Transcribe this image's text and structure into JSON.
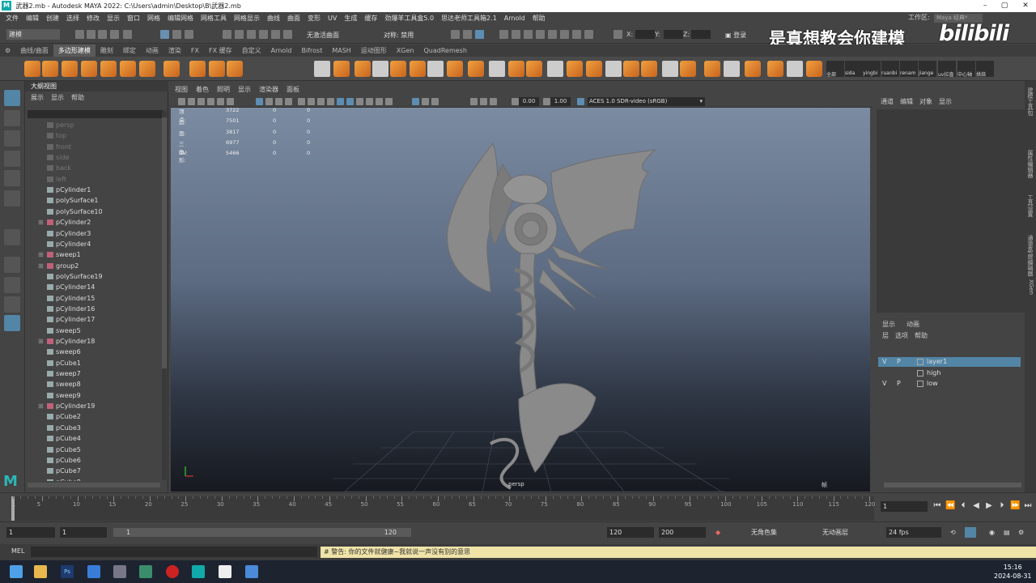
{
  "titlebar": {
    "icon": "M",
    "title": "武器2.mb - Autodesk MAYA 2022: C:\\Users\\admin\\Desktop\\B\\武器2.mb"
  },
  "menubar": [
    "文件",
    "编辑",
    "创建",
    "选择",
    "修改",
    "显示",
    "窗口",
    "网格",
    "编辑网格",
    "网格工具",
    "网格显示",
    "曲线",
    "曲面",
    "变形",
    "UV",
    "生成",
    "缓存",
    "劲爆羊工具盒5.0",
    "思达老师工具箱2.1",
    "Arnold",
    "帮助"
  ],
  "statusline": {
    "mode": "建模",
    "live_surface": "无激活曲面",
    "symmetry": "对称: 禁用",
    "x_label": "X:",
    "y_label": "Y:",
    "z_label": "Z:",
    "login": "登录",
    "workspace_label": "工作区:",
    "workspace_value": "Maya 经典*"
  },
  "watermark": {
    "text": "是真想教会你建模",
    "logo": "bilibili"
  },
  "shelf_tabs": [
    "曲线/曲面",
    "多边形建模",
    "雕刻",
    "绑定",
    "动画",
    "渲染",
    "FX",
    "FX 缓存",
    "自定义",
    "Arnold",
    "Bifrost",
    "MASH",
    "运动图形",
    "XGen",
    "QuadRemesh"
  ],
  "shelf_active": 1,
  "shelf_labels": [
    "全部",
    "sida",
    "yingbi",
    "ruanbi",
    "renam",
    "jiange",
    "uv拉直",
    "中心轴",
    "烘焙"
  ],
  "outliner": {
    "title": "大纲视图",
    "menu": [
      "展示",
      "显示",
      "帮助"
    ],
    "items": [
      {
        "name": "persp",
        "type": "cam"
      },
      {
        "name": "top",
        "type": "cam"
      },
      {
        "name": "front",
        "type": "cam"
      },
      {
        "name": "side",
        "type": "cam"
      },
      {
        "name": "back",
        "type": "cam"
      },
      {
        "name": "left",
        "type": "cam"
      },
      {
        "name": "pCylinder1",
        "type": "mesh"
      },
      {
        "name": "polySurface1",
        "type": "mesh"
      },
      {
        "name": "polySurface10",
        "type": "mesh"
      },
      {
        "name": "pCylinder2",
        "type": "group"
      },
      {
        "name": "pCylinder3",
        "type": "mesh"
      },
      {
        "name": "pCylinder4",
        "type": "mesh"
      },
      {
        "name": "sweep1",
        "type": "group"
      },
      {
        "name": "group2",
        "type": "group"
      },
      {
        "name": "polySurface19",
        "type": "mesh"
      },
      {
        "name": "pCylinder14",
        "type": "mesh"
      },
      {
        "name": "pCylinder15",
        "type": "mesh"
      },
      {
        "name": "pCylinder16",
        "type": "mesh"
      },
      {
        "name": "pCylinder17",
        "type": "mesh"
      },
      {
        "name": "sweep5",
        "type": "mesh"
      },
      {
        "name": "pCylinder18",
        "type": "group"
      },
      {
        "name": "sweep6",
        "type": "mesh"
      },
      {
        "name": "pCube1",
        "type": "mesh"
      },
      {
        "name": "sweep7",
        "type": "mesh"
      },
      {
        "name": "sweep8",
        "type": "mesh"
      },
      {
        "name": "sweep9",
        "type": "mesh"
      },
      {
        "name": "pCylinder19",
        "type": "group"
      },
      {
        "name": "pCube2",
        "type": "mesh"
      },
      {
        "name": "pCube3",
        "type": "mesh"
      },
      {
        "name": "pCube4",
        "type": "mesh"
      },
      {
        "name": "pCube5",
        "type": "mesh"
      },
      {
        "name": "pCube6",
        "type": "mesh"
      },
      {
        "name": "pCube7",
        "type": "mesh"
      },
      {
        "name": "pCube8",
        "type": "mesh"
      }
    ]
  },
  "viewport": {
    "menu": [
      "视图",
      "着色",
      "照明",
      "显示",
      "渲染器",
      "面板"
    ],
    "exposure": "0.00",
    "gamma": "1.00",
    "colorspace": "ACES 1.0 SDR-video (sRGB)",
    "hud": [
      {
        "label": "顶点:",
        "a": "3722",
        "b": "0",
        "c": "0"
      },
      {
        "label": "边:",
        "a": "7501",
        "b": "0",
        "c": "0"
      },
      {
        "label": "面:",
        "a": "3817",
        "b": "0",
        "c": "0"
      },
      {
        "label": "三角形:",
        "a": "6977",
        "b": "0",
        "c": "0"
      },
      {
        "label": "UV:",
        "a": "5466",
        "b": "0",
        "c": "0"
      }
    ],
    "camera": "persp",
    "fps": "1",
    "fps_label": "帧"
  },
  "channelbox": {
    "menu": [
      "通道",
      "编辑",
      "对象",
      "显示"
    ]
  },
  "layers": {
    "tabs": [
      "显示",
      "动画"
    ],
    "menu": [
      "层",
      "选项",
      "帮助"
    ],
    "rows": [
      {
        "v": "V",
        "p": "P",
        "name": "layer1",
        "selected": true
      },
      {
        "v": "",
        "p": "",
        "name": "high",
        "selected": false
      },
      {
        "v": "V",
        "p": "P",
        "name": "low",
        "selected": false
      }
    ]
  },
  "side_tabs": [
    "建模工具包",
    "属性编辑器",
    "工具设置",
    "通道盒/层编辑器",
    "XGen"
  ],
  "timeline": {
    "ticks": [
      "5",
      "10",
      "15",
      "20",
      "25",
      "30",
      "35",
      "40",
      "45",
      "50",
      "55",
      "60",
      "65",
      "70",
      "75",
      "80",
      "85",
      "90",
      "95",
      "100",
      "105",
      "110",
      "115",
      "120"
    ],
    "start_tick": "1",
    "current_frame": "1"
  },
  "range": {
    "start": "1",
    "anim_start": "1",
    "range_start": "1",
    "range_end": "120",
    "anim_end_a": "120",
    "anim_end_b": "200",
    "char_set": "无角色集",
    "anim_layer": "无动画层",
    "fps": "24 fps"
  },
  "cmdline": {
    "label": "MEL",
    "warning": "# 警告: 你的文件就健康~我就说一声没有别的意思"
  },
  "clock": {
    "time": "15:16",
    "date": "2024-08-31"
  },
  "colors": {
    "accent": "#5285a6",
    "viewport_top": "#7b8ba1",
    "viewport_bottom": "#16191f",
    "model": "#8a8a8a"
  }
}
